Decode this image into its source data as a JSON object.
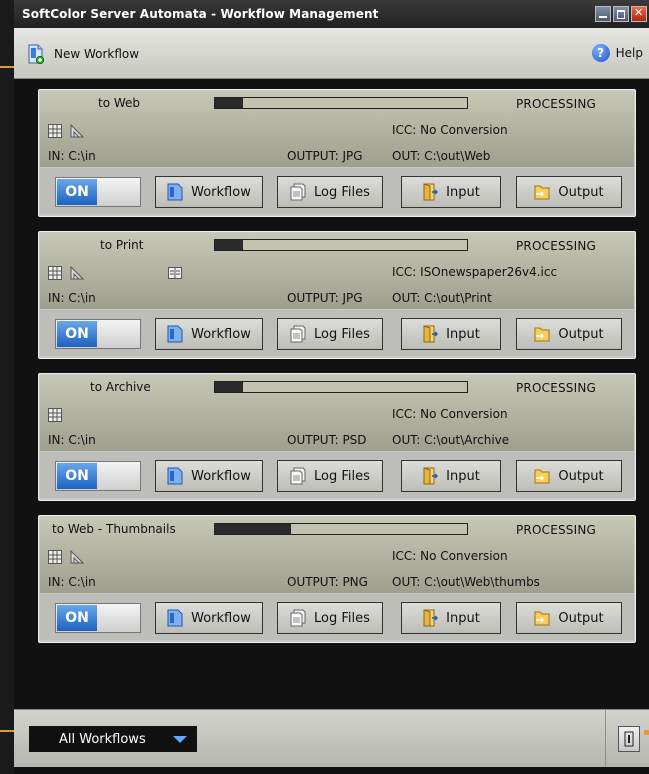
{
  "window": {
    "title": "SoftColor Server Automata - Workflow Management",
    "accent_color": "#1b62c2"
  },
  "toolbar": {
    "new_workflow_label": "New Workflow",
    "new_workflow_icon": "new-document-icon",
    "help_label": "Help",
    "help_icon": "question-circle-icon"
  },
  "workflows": [
    {
      "name": "to Web",
      "progress": 0.11,
      "status": "PROCESSING",
      "icc": "ICC: No Conversion",
      "input": "IN: C:\\in",
      "output_format": "OUTPUT: JPG",
      "output_path": "OUT: C:\\out\\Web",
      "toggle_label": "ON",
      "buttons": {
        "workflow": "Workflow",
        "log_files": "Log Files",
        "input": "Input",
        "output": "Output"
      }
    },
    {
      "name": "to Print",
      "progress": 0.11,
      "status": "PROCESSING",
      "icc": "ICC: ISOnewspaper26v4.icc",
      "input": "IN: C:\\in",
      "output_format": "OUTPUT: JPG",
      "output_path": "OUT: C:\\out\\Print",
      "toggle_label": "ON",
      "buttons": {
        "workflow": "Workflow",
        "log_files": "Log Files",
        "input": "Input",
        "output": "Output"
      }
    },
    {
      "name": "to Archive",
      "progress": 0.11,
      "status": "PROCESSING",
      "icc": "ICC: No Conversion",
      "input": "IN: C:\\in",
      "output_format": "OUTPUT: PSD",
      "output_path": "OUT: C:\\out\\Archive",
      "toggle_label": "ON",
      "buttons": {
        "workflow": "Workflow",
        "log_files": "Log Files",
        "input": "Input",
        "output": "Output"
      }
    },
    {
      "name": "to Web - Thumbnails",
      "progress": 0.3,
      "status": "PROCESSING",
      "icc": "ICC: No Conversion",
      "input": "IN: C:\\in",
      "output_format": "OUTPUT: PNG",
      "output_path": "OUT: C:\\out\\Web\\thumbs",
      "toggle_label": "ON",
      "buttons": {
        "workflow": "Workflow",
        "log_files": "Log Files",
        "input": "Input",
        "output": "Output"
      }
    }
  ],
  "footer": {
    "filter_selected": "All Workflows",
    "right_button_icon": "door-icon"
  }
}
